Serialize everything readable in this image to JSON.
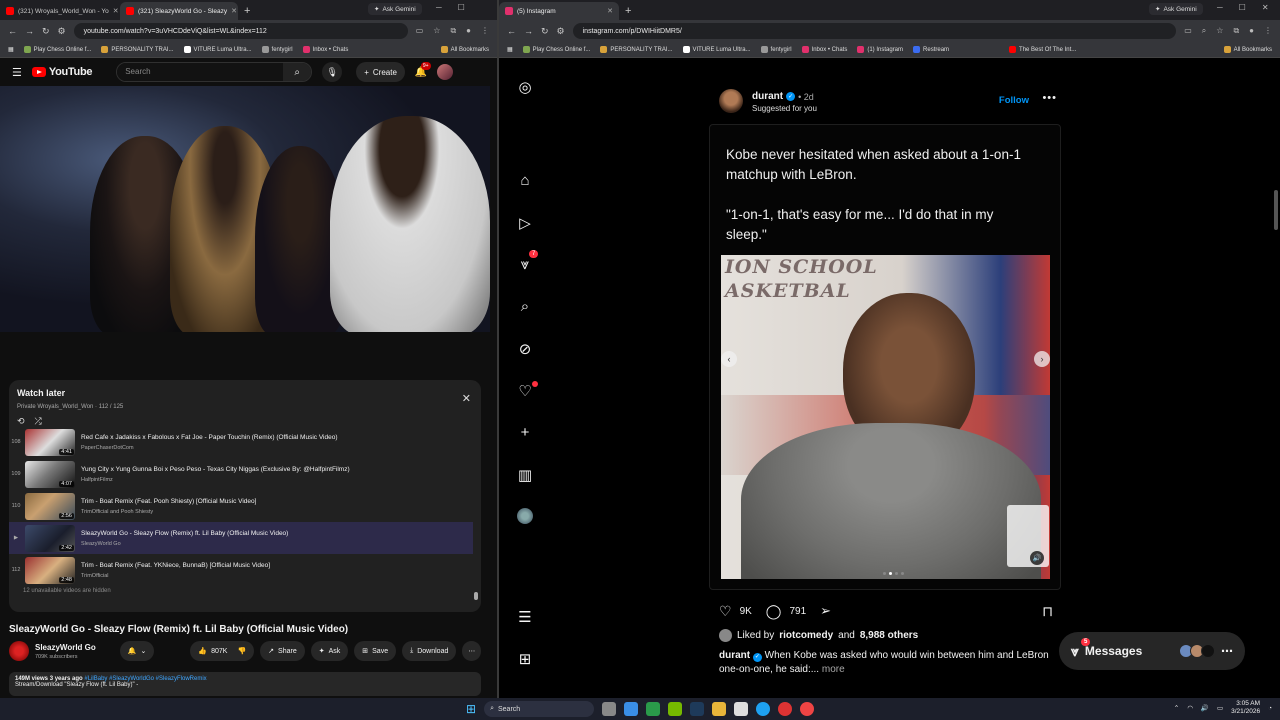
{
  "left_browser": {
    "tabs": [
      {
        "label": "(321) Wroyals_World_Won - Yo"
      },
      {
        "label": "(321) SleazyWorld Go - Sleazy"
      }
    ],
    "new_tab": "+",
    "ask_gemini": "Ask Gemini",
    "url": "youtube.com/watch?v=3uVHCDdeViQ&list=WL&index=112",
    "bookmarks": [
      "Play Chess Online f...",
      "PERSONALITY TRAI...",
      "VITURE Luma Ultra...",
      "fentygirl",
      "Inbox • Chats"
    ],
    "all_bookmarks": "All Bookmarks"
  },
  "youtube": {
    "logo_text": "YouTube",
    "search_placeholder": "Search",
    "create_label": "Create",
    "notif_count": "9+",
    "watch_later": {
      "title": "Watch later",
      "subtitle": "Private Wroyals_World_Won · 112 / 125",
      "items": [
        {
          "num": "",
          "title": "Red Cafe x Jadakiss x Fabolous x Fat Joe - Paper Touchin (Remix) (Official Music Video)",
          "channel": "PaperChaserDotCom",
          "duration": "4:41"
        },
        {
          "num": "109",
          "title": "Yung City x Yung Gunna Boi x Peso Peso - Texas City Niggas (Exclusive By: @HalfpintFilmz)",
          "channel": "HalfpintFilmz",
          "duration": "4:07"
        },
        {
          "num": "110",
          "title": "Trim - Boat Remix (Feat. Pooh Shiesty) [Official Music Video]",
          "channel": "TrimOfficial and Pooh Shiesty",
          "duration": "2:56"
        },
        {
          "num": "▶",
          "title": "SleazyWorld Go - Sleazy Flow (Remix) ft. Lil Baby (Official Music Video)",
          "channel": "SleazyWorld Go",
          "duration": "2:42"
        },
        {
          "num": "112",
          "title": "Trim - Boat Remix (Feat. YKNiece, BunnaB) [Official Music Video]",
          "channel": "TrimOfficial",
          "duration": "2:48"
        }
      ],
      "extra_nums": [
        "108",
        "111",
        "113"
      ],
      "hidden_note": "12 unavailable videos are hidden"
    },
    "video_title": "SleazyWorld Go - Sleazy Flow (Remix) ft. Lil Baby (Official Music Video)",
    "channel": "SleazyWorld Go",
    "subscribers": "709K subscribers",
    "likes": "807K",
    "share": "Share",
    "ask": "Ask",
    "save": "Save",
    "download": "Download",
    "desc_meta": "149M views  3 years ago",
    "desc_tags": "#LilBaby #SleazyWorldGo #SleazyFlowRemix",
    "desc_line2": "Stream/Download \"Sleazy Flow (ft. Lil Baby)\" -"
  },
  "right_browser": {
    "tabs": [
      {
        "label": "(5) Instagram"
      }
    ],
    "new_tab": "+",
    "ask_gemini": "Ask Gemini",
    "url": "instagram.com/p/DWIHiitDMR5/",
    "bookmarks": [
      "Play Chess Online f...",
      "PERSONALITY TRAI...",
      "VITURE Luma Ultra...",
      "fentygirl",
      "Inbox • Chats",
      "(1) Instagram",
      "Restream",
      "The Best Of The Int..."
    ],
    "all_bookmarks": "All Bookmarks"
  },
  "instagram": {
    "notif_badge": "7",
    "post": {
      "username": "durant",
      "time": "• 2d",
      "suggested": "Suggested for you",
      "follow": "Follow",
      "quote": "Kobe never hesitated when asked about a 1-on-1 matchup with LeBron.\n\n\"1-on-1, that's easy for me... I'd do that in my sleep.\"",
      "photo_banner": "ION SCHOOL\nASKETBAL",
      "likes": "9K",
      "comments": "791",
      "liked_by_user": "riotcomedy",
      "liked_by_others": "8,988 others",
      "liked_by_prefix": "Liked by",
      "liked_by_and": "and",
      "caption_user": "durant",
      "caption": "When Kobe was asked who would win between him and LeBron one-on-one, he said:...",
      "more": "more"
    },
    "messages_label": "Messages",
    "messages_badge": "5"
  },
  "taskbar": {
    "search": "Search",
    "time": "3:05 AM",
    "date": "3/21/2026"
  }
}
